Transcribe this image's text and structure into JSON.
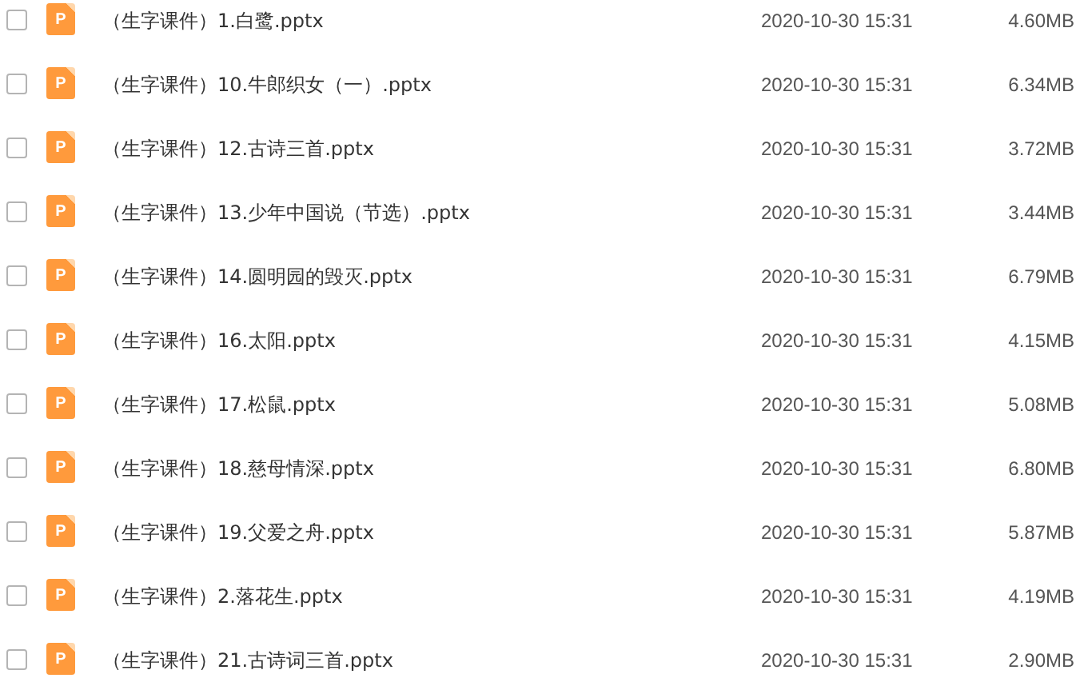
{
  "files": [
    {
      "checked": false,
      "icon_letter": "P",
      "name": "（生字课件）1.白鹭.pptx",
      "modified": "2020-10-30 15:31",
      "size": "4.60MB"
    },
    {
      "checked": false,
      "icon_letter": "P",
      "name": "（生字课件）10.牛郎织女（一）.pptx",
      "modified": "2020-10-30 15:31",
      "size": "6.34MB"
    },
    {
      "checked": false,
      "icon_letter": "P",
      "name": "（生字课件）12.古诗三首.pptx",
      "modified": "2020-10-30 15:31",
      "size": "3.72MB"
    },
    {
      "checked": false,
      "icon_letter": "P",
      "name": "（生字课件）13.少年中国说（节选）.pptx",
      "modified": "2020-10-30 15:31",
      "size": "3.44MB"
    },
    {
      "checked": false,
      "icon_letter": "P",
      "name": "（生字课件）14.圆明园的毁灭.pptx",
      "modified": "2020-10-30 15:31",
      "size": "6.79MB"
    },
    {
      "checked": false,
      "icon_letter": "P",
      "name": "（生字课件）16.太阳.pptx",
      "modified": "2020-10-30 15:31",
      "size": "4.15MB"
    },
    {
      "checked": false,
      "icon_letter": "P",
      "name": "（生字课件）17.松鼠.pptx",
      "modified": "2020-10-30 15:31",
      "size": "5.08MB"
    },
    {
      "checked": false,
      "icon_letter": "P",
      "name": "（生字课件）18.慈母情深.pptx",
      "modified": "2020-10-30 15:31",
      "size": "6.80MB"
    },
    {
      "checked": false,
      "icon_letter": "P",
      "name": "（生字课件）19.父爱之舟.pptx",
      "modified": "2020-10-30 15:31",
      "size": "5.87MB"
    },
    {
      "checked": false,
      "icon_letter": "P",
      "name": "（生字课件）2.落花生.pptx",
      "modified": "2020-10-30 15:31",
      "size": "4.19MB"
    },
    {
      "checked": false,
      "icon_letter": "P",
      "name": "（生字课件）21.古诗词三首.pptx",
      "modified": "2020-10-30 15:31",
      "size": "2.90MB"
    }
  ]
}
